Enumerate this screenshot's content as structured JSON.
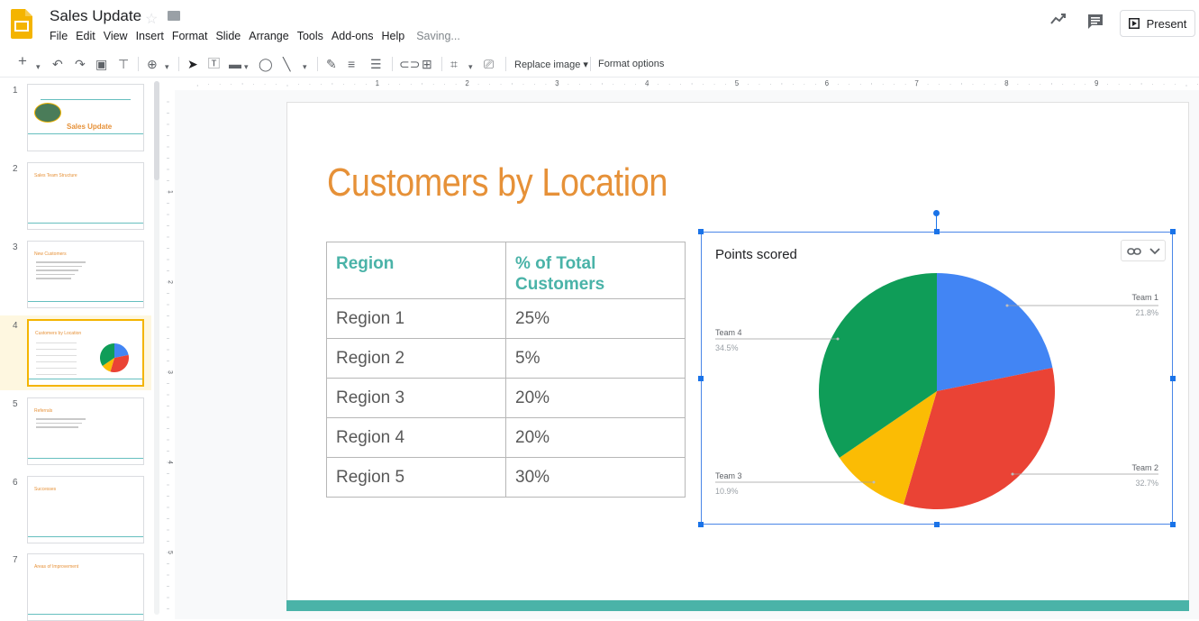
{
  "header": {
    "doc_title": "Sales Update",
    "menu": [
      "File",
      "Edit",
      "View",
      "Insert",
      "Format",
      "Slide",
      "Arrange",
      "Tools",
      "Add-ons",
      "Help"
    ],
    "status": "Saving...",
    "present_label": "Present"
  },
  "toolbar": {
    "replace_image_label": "Replace image",
    "format_options_label": "Format options"
  },
  "ruler": {
    "top_marks": [
      "1",
      "2",
      "3",
      "4",
      "5",
      "6",
      "7",
      "8",
      "9"
    ],
    "left_marks": [
      "1",
      "2",
      "3",
      "4",
      "5"
    ]
  },
  "filmstrip": {
    "slides": [
      {
        "num": "1",
        "title": "Sales Update"
      },
      {
        "num": "2",
        "title": "Sales Team Structure"
      },
      {
        "num": "3",
        "title": "New Customers"
      },
      {
        "num": "4",
        "title": "Customers by Location"
      },
      {
        "num": "5",
        "title": "Referrals"
      },
      {
        "num": "6",
        "title": "Successes"
      },
      {
        "num": "7",
        "title": "Areas of Improvement"
      }
    ],
    "selected": "4"
  },
  "slide": {
    "title": "Customers by Location",
    "table": {
      "headers": [
        "Region",
        "% of Total Customers"
      ],
      "rows": [
        [
          "Region 1",
          "25%"
        ],
        [
          "Region 2",
          "5%"
        ],
        [
          "Region 3",
          "20%"
        ],
        [
          "Region 4",
          "20%"
        ],
        [
          "Region 5",
          "30%"
        ]
      ]
    }
  },
  "chart_data": {
    "type": "pie",
    "title": "Points scored",
    "slices": [
      {
        "name": "Team 1",
        "value": 21.8,
        "label": "21.8%",
        "color": "#4285f4"
      },
      {
        "name": "Team 2",
        "value": 32.7,
        "label": "32.7%",
        "color": "#ea4335"
      },
      {
        "name": "Team 3",
        "value": 10.9,
        "label": "10.9%",
        "color": "#fbbc04"
      },
      {
        "name": "Team 4",
        "value": 34.5,
        "label": "34.5%",
        "color": "#0f9d58"
      }
    ]
  },
  "colors": {
    "accent": "#e69138",
    "teal": "#4ab3a8",
    "selection": "#1a73e8"
  }
}
